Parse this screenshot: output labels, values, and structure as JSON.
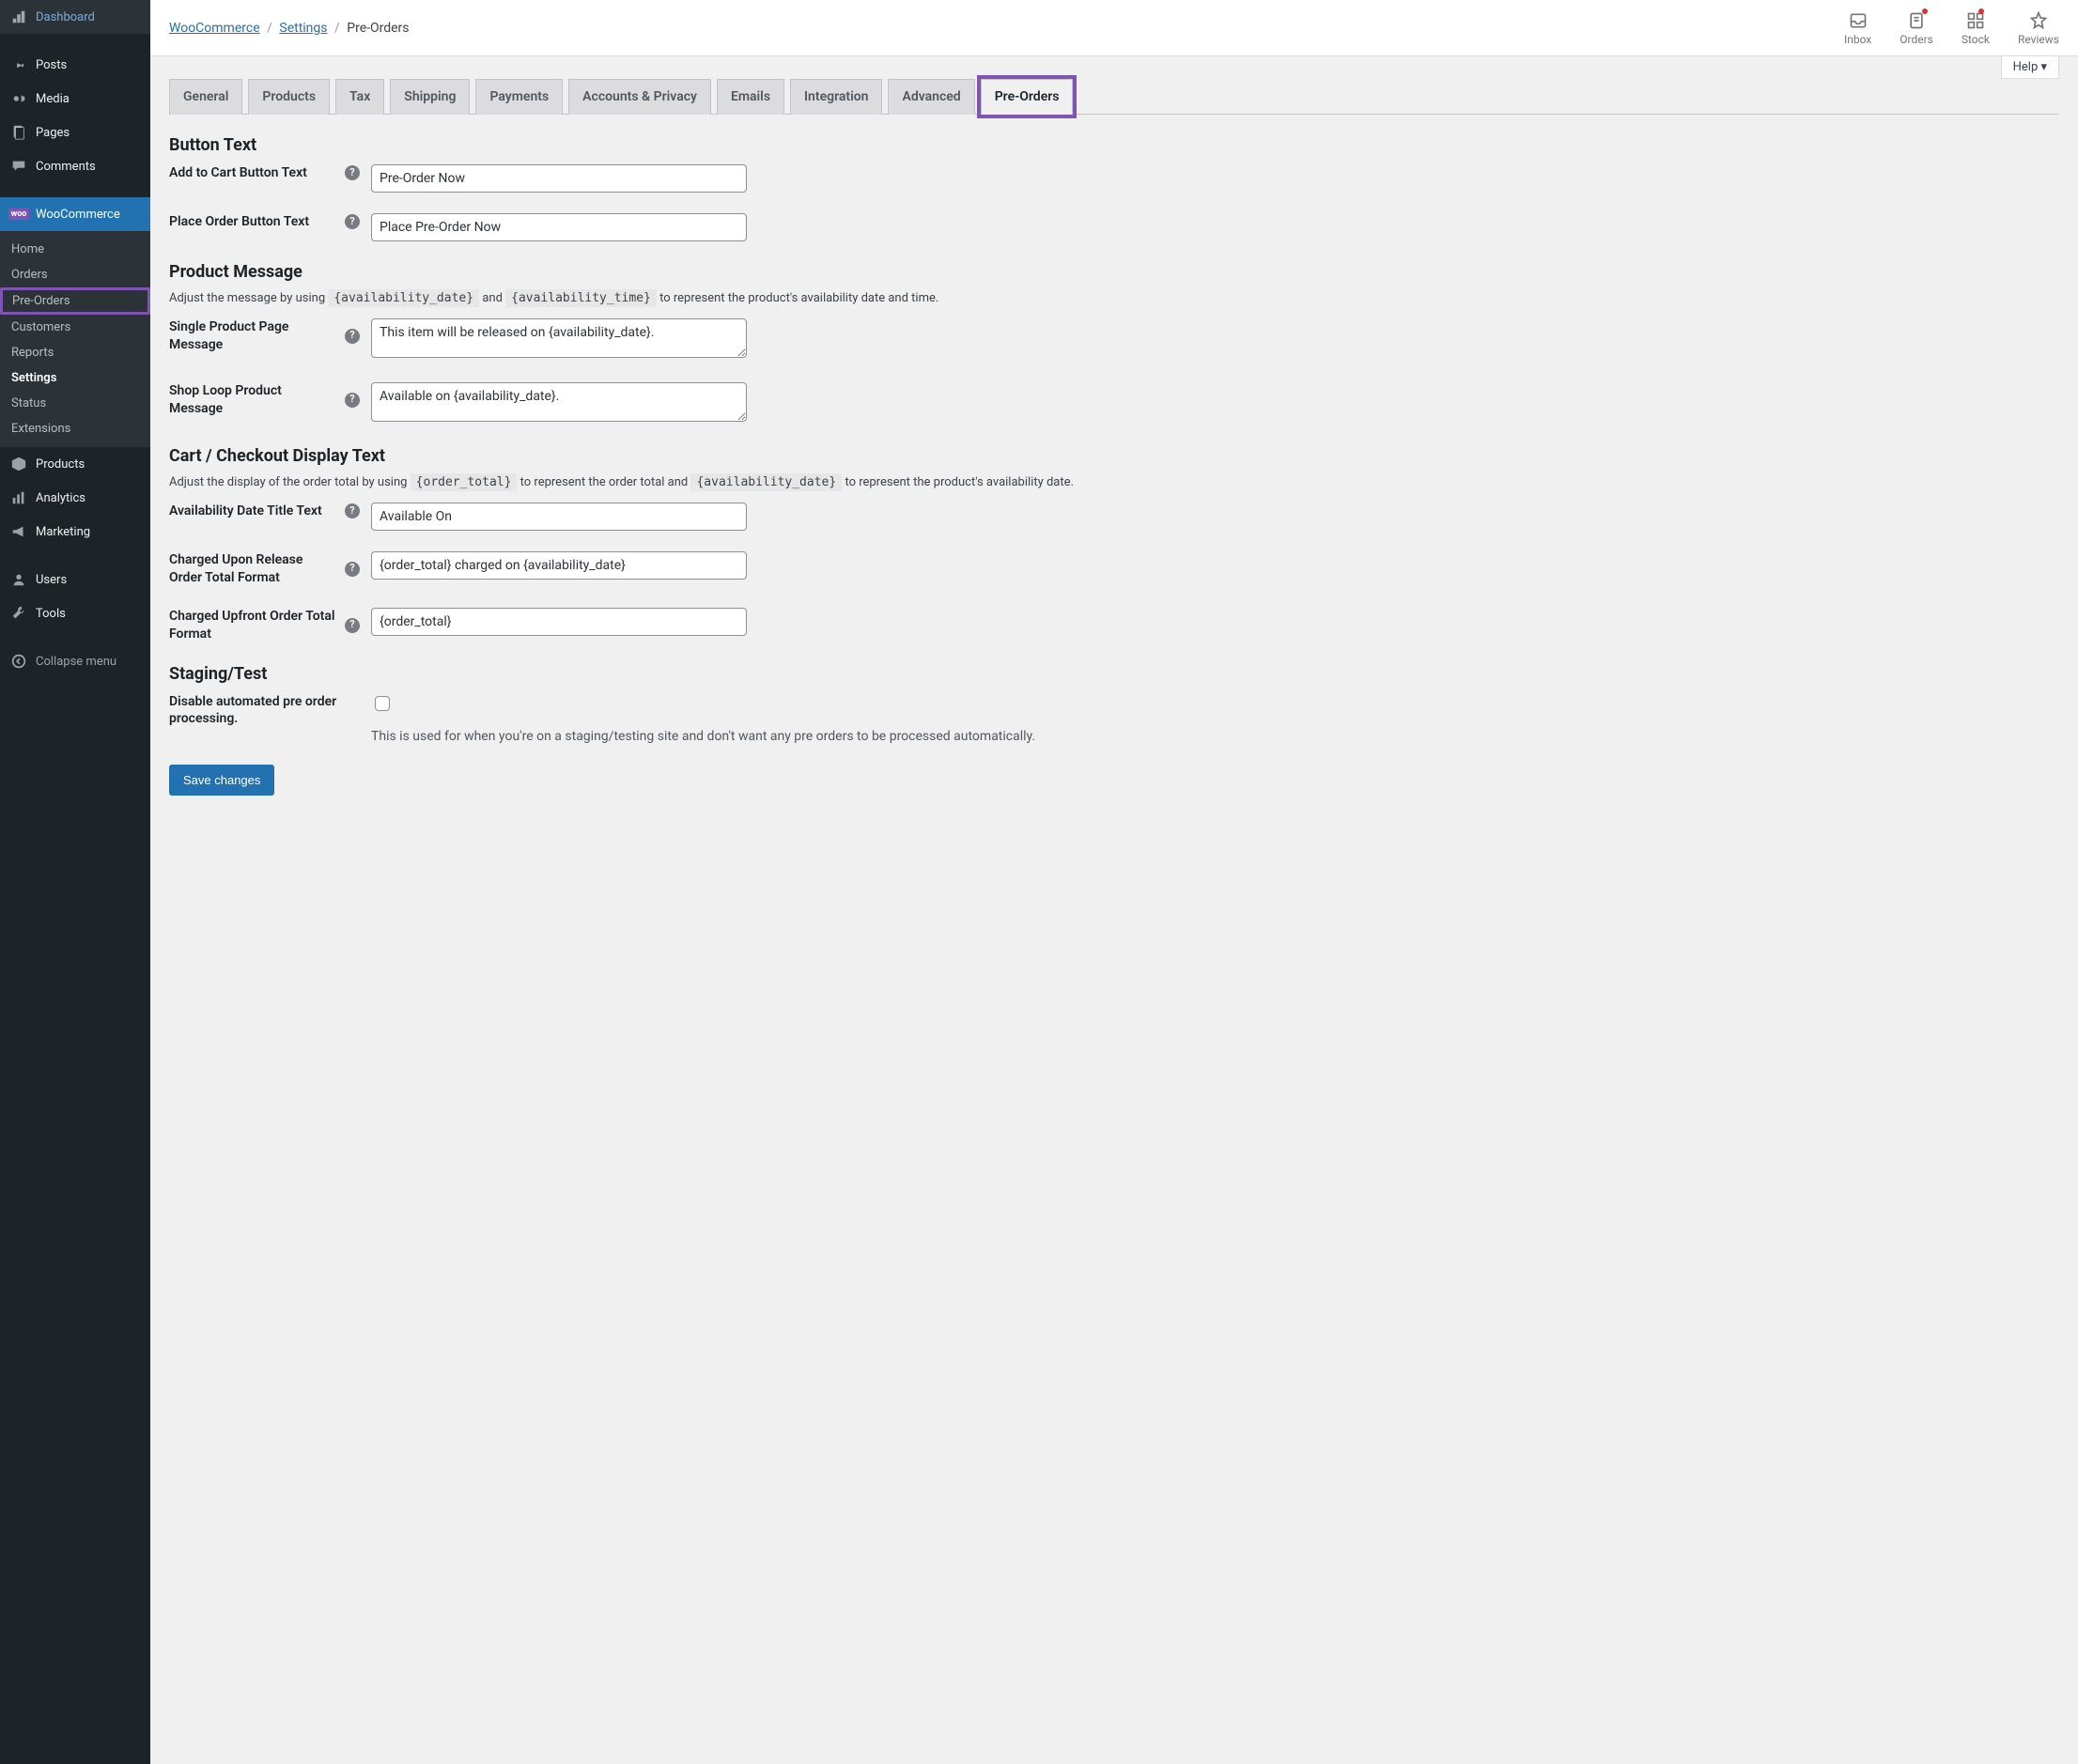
{
  "sidebar": {
    "main": [
      {
        "label": "Dashboard",
        "icon": "dashboard"
      },
      {
        "label": "Posts",
        "icon": "pin"
      },
      {
        "label": "Media",
        "icon": "media"
      },
      {
        "label": "Pages",
        "icon": "pages"
      },
      {
        "label": "Comments",
        "icon": "comments"
      },
      {
        "label": "WooCommerce",
        "icon": "woo"
      }
    ],
    "woo_sub": [
      {
        "label": "Home"
      },
      {
        "label": "Orders"
      },
      {
        "label": "Pre-Orders"
      },
      {
        "label": "Customers"
      },
      {
        "label": "Reports"
      },
      {
        "label": "Settings"
      },
      {
        "label": "Status"
      },
      {
        "label": "Extensions"
      }
    ],
    "after": [
      {
        "label": "Products",
        "icon": "products"
      },
      {
        "label": "Analytics",
        "icon": "analytics"
      },
      {
        "label": "Marketing",
        "icon": "marketing"
      },
      {
        "label": "Users",
        "icon": "users"
      },
      {
        "label": "Tools",
        "icon": "tools"
      },
      {
        "label": "Collapse menu",
        "icon": "collapse"
      }
    ]
  },
  "breadcrumb": {
    "woo": "WooCommerce",
    "settings": "Settings",
    "current": "Pre-Orders"
  },
  "topbar": {
    "inbox": "Inbox",
    "orders": "Orders",
    "stock": "Stock",
    "reviews": "Reviews"
  },
  "help_label": "Help",
  "tabs": [
    "General",
    "Products",
    "Tax",
    "Shipping",
    "Payments",
    "Accounts & Privacy",
    "Emails",
    "Integration",
    "Advanced",
    "Pre-Orders"
  ],
  "sections": {
    "button_text": "Button Text",
    "product_message": "Product Message",
    "cart_checkout": "Cart / Checkout Display Text",
    "staging": "Staging/Test"
  },
  "fields": {
    "add_to_cart_label": "Add to Cart Button Text",
    "add_to_cart_value": "Pre-Order Now",
    "place_order_label": "Place Order Button Text",
    "place_order_value": "Place Pre-Order Now",
    "product_msg_desc_pre": "Adjust the message by using ",
    "product_msg_desc_mid": " and ",
    "product_msg_desc_post": " to represent the product's availability date and time.",
    "token_date": "{availability_date}",
    "token_time": "{availability_time}",
    "single_product_label": "Single Product Page Message",
    "single_product_value": "This item will be released on {availability_date}.",
    "shop_loop_label": "Shop Loop Product Message",
    "shop_loop_value": "Available on {availability_date}.",
    "cart_desc_pre": "Adjust the display of the order total by using ",
    "cart_desc_mid": " to represent the order total and ",
    "cart_desc_post": " to represent the product's availability date.",
    "token_order_total": "{order_total}",
    "avail_title_label": "Availability Date Title Text",
    "avail_title_value": "Available On",
    "charged_release_label": "Charged Upon Release Order Total Format",
    "charged_release_value": "{order_total} charged on {availability_date}",
    "charged_upfront_label": "Charged Upfront Order Total Format",
    "charged_upfront_value": "{order_total}",
    "disable_label": "Disable automated pre order processing.",
    "disable_hint": "This is used for when you're on a staging/testing site and don't want any pre orders to be processed automatically."
  },
  "save_label": "Save changes"
}
